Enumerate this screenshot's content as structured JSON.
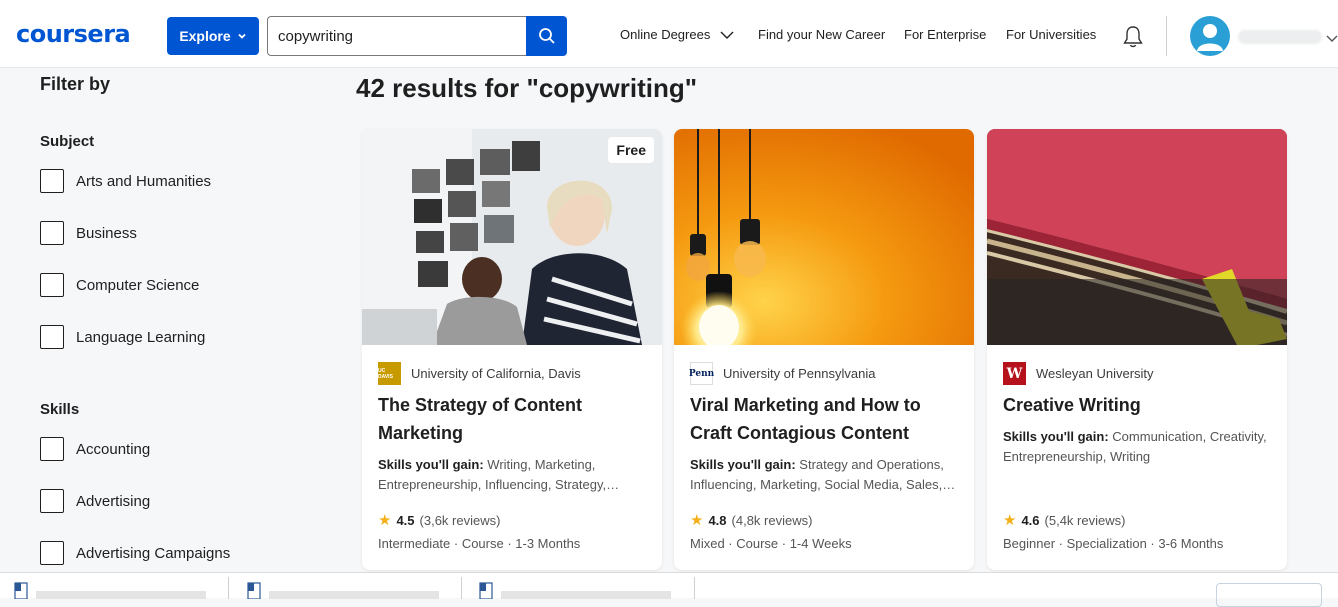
{
  "header": {
    "logo": "coursera",
    "explore_label": "Explore",
    "search_value": "copywriting",
    "nav": [
      "Online Degrees",
      "Find your New Career",
      "For Enterprise",
      "For Universities"
    ]
  },
  "filters": {
    "title": "Filter by",
    "subject": {
      "heading": "Subject",
      "options": [
        "Arts and Humanities",
        "Business",
        "Computer Science",
        "Language Learning"
      ]
    },
    "skills": {
      "heading": "Skills",
      "options": [
        "Accounting",
        "Advertising",
        "Advertising Campaigns"
      ]
    }
  },
  "results": {
    "title": "42 results for \"copywriting\"",
    "cards": [
      {
        "badge": "Free",
        "partner": "University of California, Davis",
        "partner_logo_text": "UC DAVIS",
        "title": "The Strategy of Content Marketing",
        "skills_label": "Skills you'll gain:",
        "skills": "Writing, Marketing, Entrepreneurship, Influencing, Strategy, Communication",
        "rating": "4.5",
        "reviews": "(3,6k reviews)",
        "meta": "Intermediate · Course · 1-3 Months"
      },
      {
        "badge": "",
        "partner": "University of Pennsylvania",
        "partner_logo_text": "Penn",
        "title": "Viral Marketing and How to Craft Contagious Content",
        "skills_label": "Skills you'll gain:",
        "skills": "Strategy and Operations, Influencing, Marketing, Social Media, Sales, Communication",
        "rating": "4.8",
        "reviews": "(4,8k reviews)",
        "meta": "Mixed · Course · 1-4 Weeks"
      },
      {
        "badge": "",
        "partner": "Wesleyan University",
        "partner_logo_text": "W",
        "title": "Creative Writing",
        "skills_label": "Skills you'll gain:",
        "skills": "Communication, Creativity, Entrepreneurship, Writing",
        "rating": "4.6",
        "reviews": "(5,4k reviews)",
        "meta": "Beginner · Specialization · 3-6 Months"
      }
    ]
  },
  "colors": {
    "brand": "#0056d2",
    "star": "#f5b01a",
    "ucd_gold": "#c79a00",
    "wesleyan_red": "#b5121b"
  }
}
